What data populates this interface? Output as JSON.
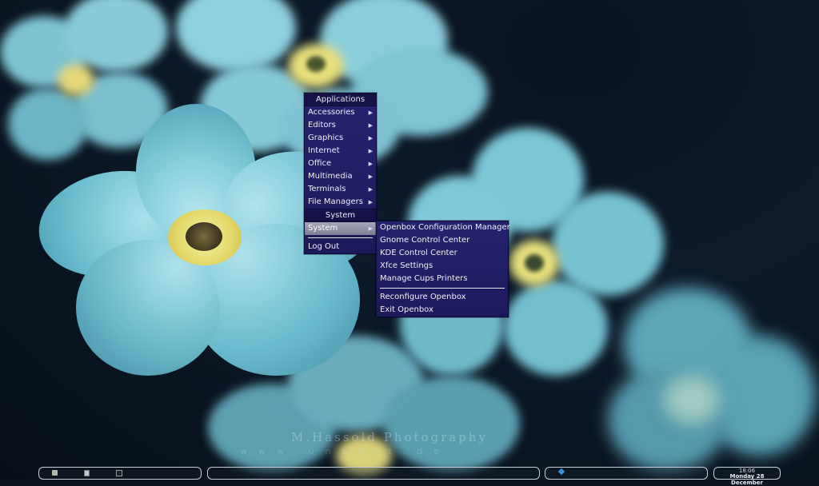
{
  "wallpaper": {
    "watermark_line1": "M.Hassold Photography",
    "watermark_line2": "www.uncult.de"
  },
  "applications_menu": {
    "title": "Applications",
    "items": [
      {
        "label": "Accessories",
        "has_submenu": true
      },
      {
        "label": "Editors",
        "has_submenu": true
      },
      {
        "label": "Graphics",
        "has_submenu": true
      },
      {
        "label": "Internet",
        "has_submenu": true
      },
      {
        "label": "Office",
        "has_submenu": true
      },
      {
        "label": "Multimedia",
        "has_submenu": true
      },
      {
        "label": "Terminals",
        "has_submenu": true
      },
      {
        "label": "File Managers",
        "has_submenu": true
      }
    ],
    "system_header": "System",
    "system_item": {
      "label": "System",
      "has_submenu": true,
      "active": true
    },
    "logout_label": "Log Out"
  },
  "system_submenu": {
    "items": [
      "Openbox Configuration Manager",
      "Gnome Control Center",
      "KDE Control Center",
      "Xfce Settings",
      "Manage Cups Printers"
    ],
    "items_after_separator": [
      "Reconfigure Openbox",
      "Exit Openbox"
    ]
  },
  "panel": {
    "clock_time": "18:06",
    "clock_date": "Monday 28 December"
  },
  "colors": {
    "menu_bg": "#25236e",
    "menu_title_bg": "#141247",
    "menu_active": "#8e8ea4",
    "menu_text": "#f0f0f8"
  }
}
